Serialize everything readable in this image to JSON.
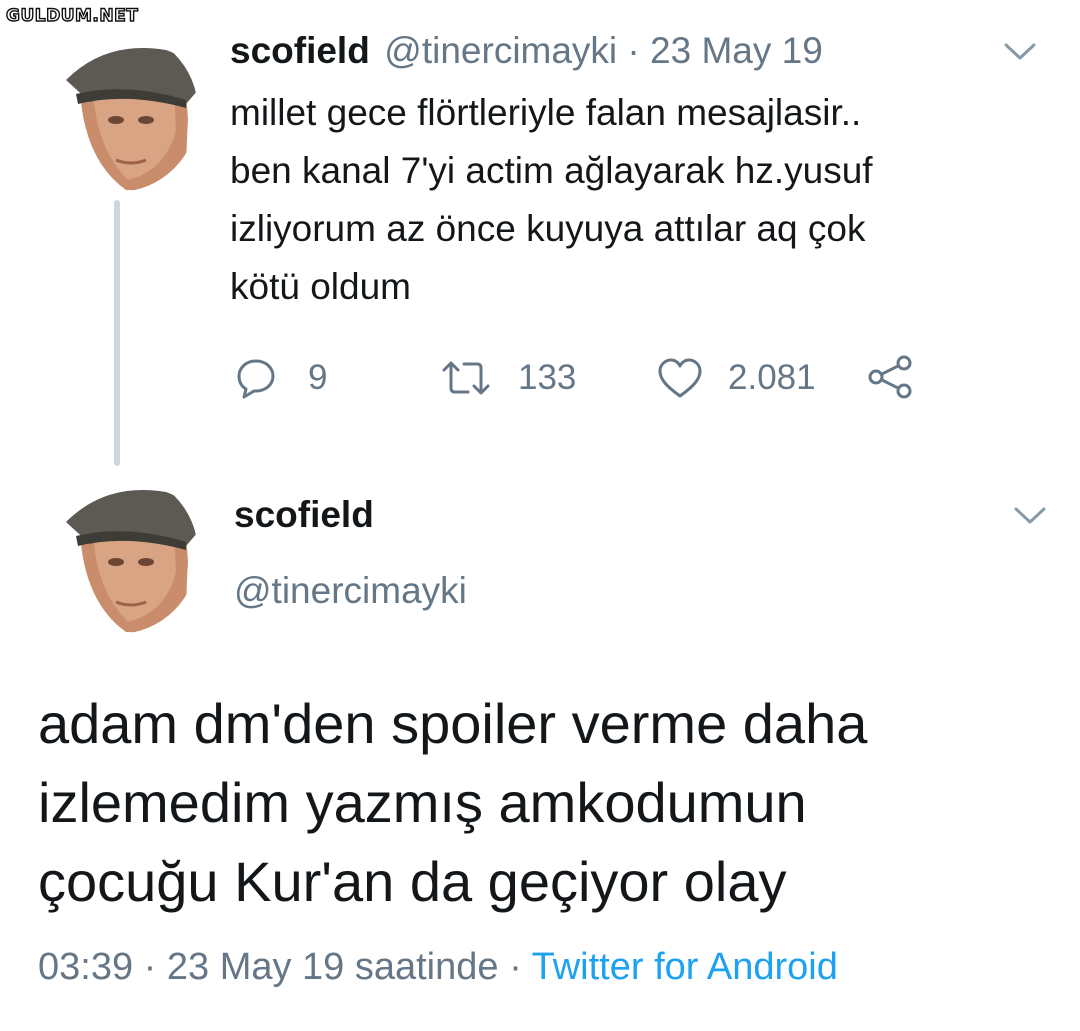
{
  "watermark": "GULDUM.NET",
  "first_tweet": {
    "display_name": "scofield",
    "handle_time": "@tinercimayki · 23 May 19",
    "lines": [
      "millet gece flörtleriyle falan mesajlasir..",
      "ben kanal 7'yi actim ağlayarak hz.yusuf",
      "izliyorum az önce kuyuya attılar aq çok",
      "kötü oldum"
    ],
    "reply_count": "9",
    "retweet_count": "133",
    "like_count": "2.081"
  },
  "second_tweet": {
    "display_name": "scofield",
    "handle": "@tinercimayki",
    "lines": [
      "adam dm'den spoiler verme daha",
      "izlemedim yazmış amkodumun",
      "çocuğu Kur'an da geçiyor olay"
    ],
    "timestamp": "03:39 · 23 May 19 saatinde",
    "separator": "·",
    "source": "Twitter for Android"
  },
  "colors": {
    "text": "#14171a",
    "muted": "#657786",
    "link": "#1da1f2",
    "thread": "#cdd5dd"
  },
  "icons": [
    "reply-icon",
    "retweet-icon",
    "like-icon",
    "share-icon",
    "chevron-down-icon",
    "avatar"
  ]
}
